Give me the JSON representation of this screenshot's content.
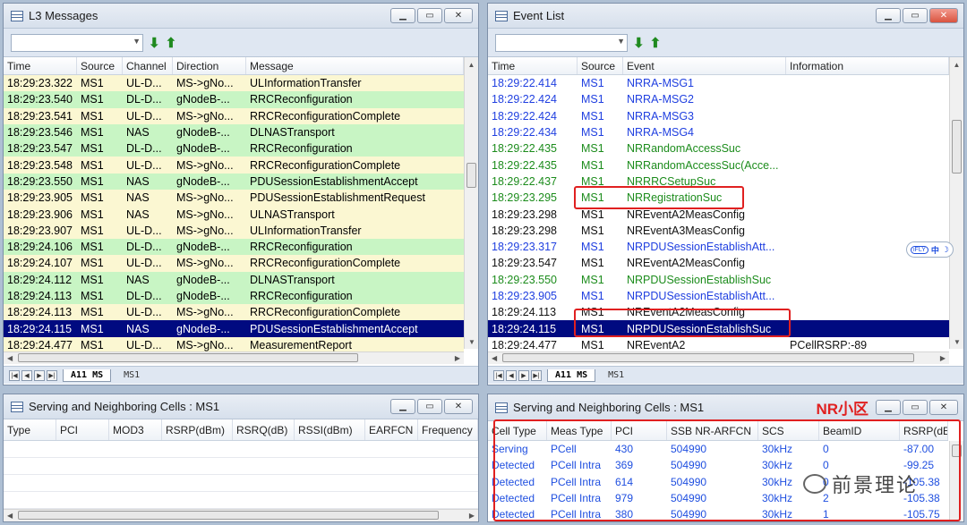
{
  "l3": {
    "title": "L3 Messages",
    "columns": [
      "Time",
      "Source",
      "Channel",
      "Direction",
      "Message"
    ],
    "rows": [
      {
        "time": "18:29:23.322",
        "source": "MS1",
        "channel": "UL-D...",
        "direction": "MS->gNo...",
        "message": "ULInformationTransfer",
        "bg": "y"
      },
      {
        "time": "18:29:23.540",
        "source": "MS1",
        "channel": "DL-D...",
        "direction": "gNodeB-...",
        "message": "RRCReconfiguration",
        "bg": "g"
      },
      {
        "time": "18:29:23.541",
        "source": "MS1",
        "channel": "UL-D...",
        "direction": "MS->gNo...",
        "message": "RRCReconfigurationComplete",
        "bg": "y"
      },
      {
        "time": "18:29:23.546",
        "source": "MS1",
        "channel": "NAS",
        "direction": "gNodeB-...",
        "message": "DLNASTransport",
        "bg": "g"
      },
      {
        "time": "18:29:23.547",
        "source": "MS1",
        "channel": "DL-D...",
        "direction": "gNodeB-...",
        "message": "RRCReconfiguration",
        "bg": "g"
      },
      {
        "time": "18:29:23.548",
        "source": "MS1",
        "channel": "UL-D...",
        "direction": "MS->gNo...",
        "message": "RRCReconfigurationComplete",
        "bg": "y"
      },
      {
        "time": "18:29:23.550",
        "source": "MS1",
        "channel": "NAS",
        "direction": "gNodeB-...",
        "message": "PDUSessionEstablishmentAccept",
        "bg": "g"
      },
      {
        "time": "18:29:23.905",
        "source": "MS1",
        "channel": "NAS",
        "direction": "MS->gNo...",
        "message": "PDUSessionEstablishmentRequest",
        "bg": "y"
      },
      {
        "time": "18:29:23.906",
        "source": "MS1",
        "channel": "NAS",
        "direction": "MS->gNo...",
        "message": "ULNASTransport",
        "bg": "y"
      },
      {
        "time": "18:29:23.907",
        "source": "MS1",
        "channel": "UL-D...",
        "direction": "MS->gNo...",
        "message": "ULInformationTransfer",
        "bg": "y"
      },
      {
        "time": "18:29:24.106",
        "source": "MS1",
        "channel": "DL-D...",
        "direction": "gNodeB-...",
        "message": "RRCReconfiguration",
        "bg": "g"
      },
      {
        "time": "18:29:24.107",
        "source": "MS1",
        "channel": "UL-D...",
        "direction": "MS->gNo...",
        "message": "RRCReconfigurationComplete",
        "bg": "y"
      },
      {
        "time": "18:29:24.112",
        "source": "MS1",
        "channel": "NAS",
        "direction": "gNodeB-...",
        "message": "DLNASTransport",
        "bg": "g"
      },
      {
        "time": "18:29:24.113",
        "source": "MS1",
        "channel": "DL-D...",
        "direction": "gNodeB-...",
        "message": "RRCReconfiguration",
        "bg": "g"
      },
      {
        "time": "18:29:24.113",
        "source": "MS1",
        "channel": "UL-D...",
        "direction": "MS->gNo...",
        "message": "RRCReconfigurationComplete",
        "bg": "y"
      },
      {
        "time": "18:29:24.115",
        "source": "MS1",
        "channel": "NAS",
        "direction": "gNodeB-...",
        "message": "PDUSessionEstablishmentAccept",
        "bg": "sel"
      },
      {
        "time": "18:29:24.477",
        "source": "MS1",
        "channel": "UL-D...",
        "direction": "MS->gNo...",
        "message": "MeasurementReport",
        "bg": "y"
      }
    ],
    "tabs": [
      "A11 MS",
      "MS1"
    ]
  },
  "events": {
    "title": "Event List",
    "columns": [
      "Time",
      "Source",
      "Event",
      "Information"
    ],
    "rows": [
      {
        "time": "18:29:22.414",
        "source": "MS1",
        "event": "NRRA-MSG1",
        "info": "",
        "color": "blue"
      },
      {
        "time": "18:29:22.424",
        "source": "MS1",
        "event": "NRRA-MSG2",
        "info": "",
        "color": "blue"
      },
      {
        "time": "18:29:22.424",
        "source": "MS1",
        "event": "NRRA-MSG3",
        "info": "",
        "color": "blue"
      },
      {
        "time": "18:29:22.434",
        "source": "MS1",
        "event": "NRRA-MSG4",
        "info": "",
        "color": "blue"
      },
      {
        "time": "18:29:22.435",
        "source": "MS1",
        "event": "NRRandomAccessSuc",
        "info": "",
        "color": "green"
      },
      {
        "time": "18:29:22.435",
        "source": "MS1",
        "event": "NRRandomAccessSuc(Acce...",
        "info": "",
        "color": "green"
      },
      {
        "time": "18:29:22.437",
        "source": "MS1",
        "event": "NRRRCSetupSuc",
        "info": "",
        "color": "green"
      },
      {
        "time": "18:29:23.295",
        "source": "MS1",
        "event": "NRRegistrationSuc",
        "info": "",
        "color": "green"
      },
      {
        "time": "18:29:23.298",
        "source": "MS1",
        "event": "NREventA2MeasConfig",
        "info": "",
        "color": "black"
      },
      {
        "time": "18:29:23.298",
        "source": "MS1",
        "event": "NREventA3MeasConfig",
        "info": "",
        "color": "black"
      },
      {
        "time": "18:29:23.317",
        "source": "MS1",
        "event": "NRPDUSessionEstablishAtt...",
        "info": "",
        "color": "blue"
      },
      {
        "time": "18:29:23.547",
        "source": "MS1",
        "event": "NREventA2MeasConfig",
        "info": "",
        "color": "black"
      },
      {
        "time": "18:29:23.550",
        "source": "MS1",
        "event": "NRPDUSessionEstablishSuc",
        "info": "",
        "color": "green"
      },
      {
        "time": "18:29:23.905",
        "source": "MS1",
        "event": "NRPDUSessionEstablishAtt...",
        "info": "",
        "color": "blue"
      },
      {
        "time": "18:29:24.113",
        "source": "MS1",
        "event": "NREventA2MeasConfig",
        "info": "",
        "color": "black"
      },
      {
        "time": "18:29:24.115",
        "source": "MS1",
        "event": "NRPDUSessionEstablishSuc",
        "info": "",
        "color": "sel"
      },
      {
        "time": "18:29:24.477",
        "source": "MS1",
        "event": "NREventA2",
        "info": "PCellRSRP:-89",
        "color": "black"
      }
    ],
    "tabs": [
      "A11 MS",
      "MS1"
    ]
  },
  "serving_left": {
    "title": "Serving and Neighboring Cells : MS1",
    "columns": [
      "Type",
      "PCI",
      "MOD3",
      "RSRP(dBm)",
      "RSRQ(dB)",
      "RSSI(dBm)",
      "EARFCN",
      "Frequency"
    ]
  },
  "serving_right": {
    "title": "Serving and Neighboring Cells : MS1",
    "annotation": "NR小区",
    "columns": [
      "Cell Type",
      "Meas Type",
      "PCI",
      "SSB NR-ARFCN",
      "SCS",
      "BeamID",
      "RSRP(dE"
    ],
    "rows": [
      {
        "cell_type": "Serving",
        "meas_type": "PCell",
        "pci": "430",
        "arfcn": "504990",
        "scs": "30kHz",
        "beam": "0",
        "rsrp": "-87.00"
      },
      {
        "cell_type": "Detected",
        "meas_type": "PCell Intra",
        "pci": "369",
        "arfcn": "504990",
        "scs": "30kHz",
        "beam": "0",
        "rsrp": "-99.25"
      },
      {
        "cell_type": "Detected",
        "meas_type": "PCell Intra",
        "pci": "614",
        "arfcn": "504990",
        "scs": "30kHz",
        "beam": "0",
        "rsrp": "-105.38"
      },
      {
        "cell_type": "Detected",
        "meas_type": "PCell Intra",
        "pci": "979",
        "arfcn": "504990",
        "scs": "30kHz",
        "beam": "2",
        "rsrp": "-105.38"
      },
      {
        "cell_type": "Detected",
        "meas_type": "PCell Intra",
        "pci": "380",
        "arfcn": "504990",
        "scs": "30kHz",
        "beam": "1",
        "rsrp": "-105.75"
      }
    ]
  },
  "watermark": "前景理论",
  "ime_widget": "中"
}
